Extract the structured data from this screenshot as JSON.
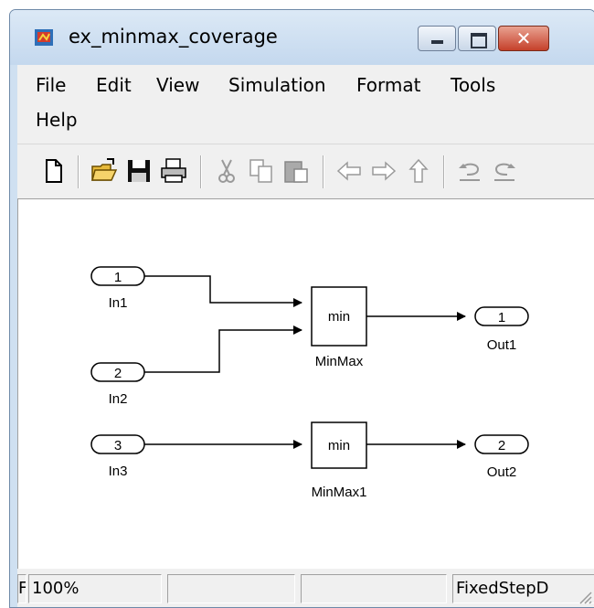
{
  "window": {
    "title": "ex_minmax_coverage"
  },
  "menubar": {
    "items": [
      "File",
      "Edit",
      "View",
      "Simulation",
      "Format",
      "Tools",
      "Help"
    ]
  },
  "toolbar": {
    "buttons": [
      "new-icon",
      "open-icon",
      "save-icon",
      "print-icon",
      "cut-icon",
      "copy-icon",
      "paste-icon",
      "back-icon",
      "forward-icon",
      "up-icon",
      "undo-icon",
      "redo-icon"
    ]
  },
  "diagram": {
    "inports": [
      {
        "number": "1",
        "label": "In1"
      },
      {
        "number": "2",
        "label": "In2"
      },
      {
        "number": "3",
        "label": "In3"
      }
    ],
    "blocks": [
      {
        "text": "min",
        "label": "MinMax"
      },
      {
        "text": "min",
        "label": "MinMax1"
      }
    ],
    "outports": [
      {
        "number": "1",
        "label": "Out1"
      },
      {
        "number": "2",
        "label": "Out2"
      }
    ]
  },
  "statusbar": {
    "clip_text": "F",
    "zoom": "100%",
    "pane2": "",
    "pane3": "",
    "solver": "FixedStepD"
  }
}
